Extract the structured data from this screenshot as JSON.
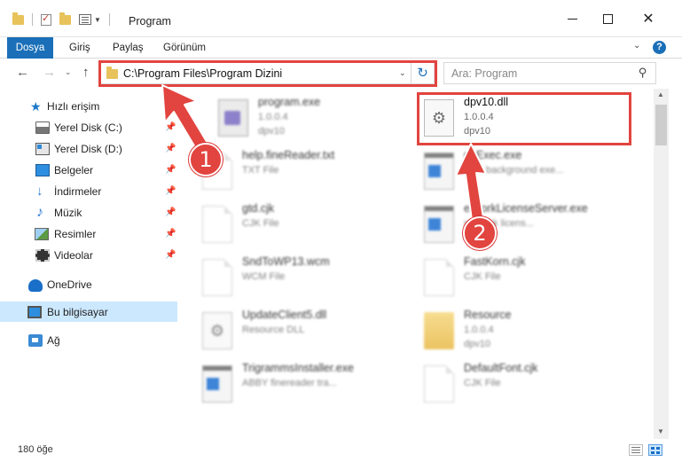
{
  "window": {
    "title": "Program",
    "minimize_glyph": "",
    "close_glyph": "✕"
  },
  "ribbon": {
    "tabs": [
      "Dosya",
      "Giriş",
      "Paylaş",
      "Görünüm"
    ],
    "help_glyph": "?",
    "expand_glyph": "⌄"
  },
  "navbar": {
    "back_glyph": "←",
    "forward_glyph": "→",
    "recent_glyph": "⌄",
    "up_glyph": "↑",
    "address": "C:\\Program Files\\Program Dizini",
    "address_dropdown_glyph": "⌄",
    "refresh_glyph": "↻",
    "search_placeholder": "Ara: Program",
    "search_glyph": "⚲"
  },
  "sidebar": {
    "pin_glyph": "📌",
    "items": [
      {
        "label": "Hızlı erişim",
        "icon": "quick-access-star-icon"
      },
      {
        "label": "Yerel Disk (C:)",
        "icon": "local-disk-c-icon",
        "pinned": true
      },
      {
        "label": "Yerel Disk (D:)",
        "icon": "local-disk-d-icon",
        "pinned": true
      },
      {
        "label": "Belgeler",
        "icon": "documents-icon",
        "pinned": true
      },
      {
        "label": "İndirmeler",
        "icon": "downloads-icon",
        "pinned": true
      },
      {
        "label": "Müzik",
        "icon": "music-icon",
        "pinned": true
      },
      {
        "label": "Resimler",
        "icon": "pictures-icon",
        "pinned": true
      },
      {
        "label": "Videolar",
        "icon": "videos-icon",
        "pinned": true
      },
      {
        "label": "OneDrive",
        "icon": "onedrive-cloud-icon"
      },
      {
        "label": "Bu bilgisayar",
        "icon": "this-pc-icon",
        "selected": true
      },
      {
        "label": "Ağ",
        "icon": "network-icon"
      }
    ]
  },
  "files": [
    {
      "name": "program.exe",
      "line2": "1.0.0.4",
      "line3": "dpv10",
      "icon": "program-exe-icon",
      "blurred": true
    },
    {
      "name": "dpv10.dll",
      "line2": "1.0.0.4",
      "line3": "dpv10",
      "icon": "dll-gear-icon",
      "blurred": false
    },
    {
      "name": "help.fineReader.txt",
      "line2": "TXT File",
      "line3": "",
      "icon": "text-file-icon",
      "blurred": true
    },
    {
      "name": "peExec.exe",
      "line2": "BBY background exe...",
      "line3": "",
      "icon": "exe-file-icon",
      "blurred": true
    },
    {
      "name": "gtd.cjk",
      "line2": "CJK File",
      "line3": "",
      "icon": "blank-file-icon",
      "blurred": true
    },
    {
      "name": "etworkLicenseServer.exe",
      "line2": "network licens...",
      "line3": "",
      "icon": "exe-file-icon",
      "blurred": true
    },
    {
      "name": "SndToWP13.wcm",
      "line2": "WCM File",
      "line3": "",
      "icon": "blank-file-icon",
      "blurred": true
    },
    {
      "name": "FastKorn.cjk",
      "line2": "CJK File",
      "line3": "",
      "icon": "blank-file-icon",
      "blurred": true
    },
    {
      "name": "UpdateClient5.dll",
      "line2": "Resource DLL",
      "line3": "",
      "icon": "dll-gear-icon",
      "blurred": true
    },
    {
      "name": "Resource",
      "line2": "1.0.0.4",
      "line3": "dpv10",
      "icon": "folder-icon",
      "blurred": true
    },
    {
      "name": "TrigrammsInstaller.exe",
      "line2": "ABBY finereader tra...",
      "line3": "",
      "icon": "exe-file-icon",
      "blurred": true
    },
    {
      "name": "DefaultFont.cjk",
      "line2": "CJK File",
      "line3": "",
      "icon": "blank-file-icon",
      "blurred": true
    }
  ],
  "annotations": {
    "step1": "1",
    "step2": "2",
    "highlight_color": "#e2443f"
  },
  "status": {
    "item_count": "180 öğe"
  },
  "colors": {
    "accent": "#1a6fb8",
    "selected_bg": "#cce8ff"
  }
}
